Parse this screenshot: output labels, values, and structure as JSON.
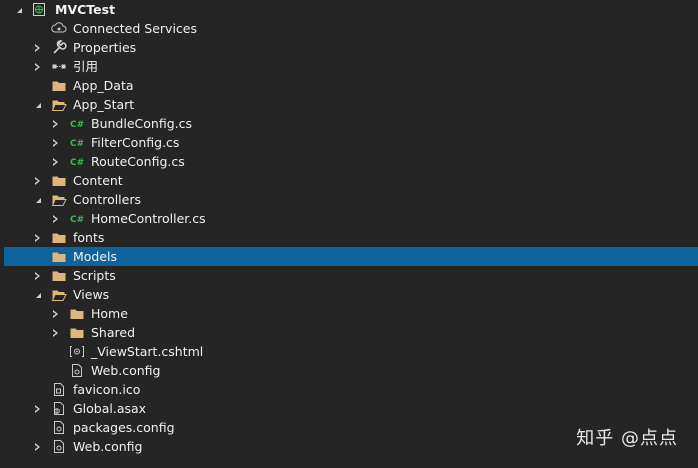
{
  "solution_explorer": {
    "project_name": "MVCTest",
    "items": [
      {
        "label": "Connected Services",
        "icon": "connected-services-icon"
      },
      {
        "label": "Properties",
        "icon": "wrench-icon"
      },
      {
        "label": "引用",
        "icon": "references-icon"
      },
      {
        "label": "App_Data",
        "icon": "folder-icon"
      },
      {
        "label": "App_Start",
        "icon": "folder-open-icon"
      },
      {
        "label": "BundleConfig.cs",
        "icon": "csharp-file-icon"
      },
      {
        "label": "FilterConfig.cs",
        "icon": "csharp-file-icon"
      },
      {
        "label": "RouteConfig.cs",
        "icon": "csharp-file-icon"
      },
      {
        "label": "Content",
        "icon": "folder-icon"
      },
      {
        "label": "Controllers",
        "icon": "folder-open-icon"
      },
      {
        "label": "HomeController.cs",
        "icon": "csharp-file-icon"
      },
      {
        "label": "fonts",
        "icon": "folder-icon"
      },
      {
        "label": "Models",
        "icon": "folder-icon"
      },
      {
        "label": "Scripts",
        "icon": "folder-icon"
      },
      {
        "label": "Views",
        "icon": "folder-open-icon"
      },
      {
        "label": "Home",
        "icon": "folder-icon"
      },
      {
        "label": "Shared",
        "icon": "folder-icon"
      },
      {
        "label": "_ViewStart.cshtml",
        "icon": "razor-file-icon"
      },
      {
        "label": "Web.config",
        "icon": "config-file-icon"
      },
      {
        "label": "favicon.ico",
        "icon": "icon-file-icon"
      },
      {
        "label": "Global.asax",
        "icon": "asax-file-icon"
      },
      {
        "label": "packages.config",
        "icon": "config-file-icon"
      },
      {
        "label": "Web.config",
        "icon": "config-file-icon"
      }
    ],
    "selected_item": "Models"
  },
  "watermark": "知乎 @点点",
  "colors": {
    "background": "#252526",
    "selection": "#0e639c",
    "folder": "#dcb67a",
    "csharp": "#3fb950",
    "text": "#f1f1f1"
  }
}
